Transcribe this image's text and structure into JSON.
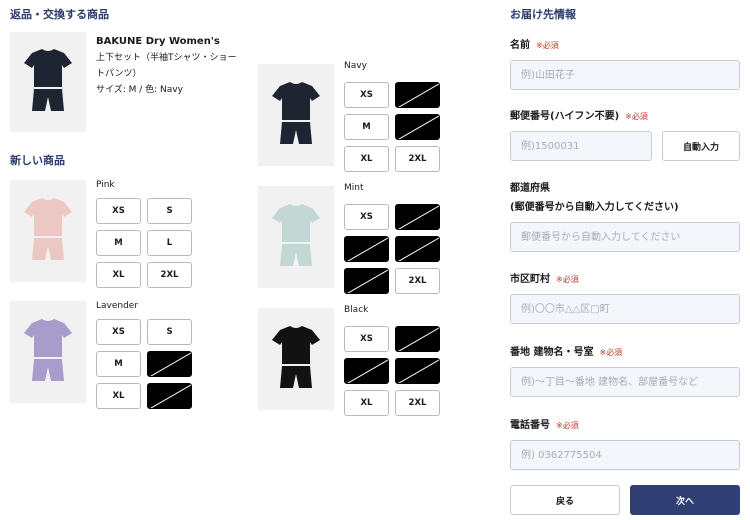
{
  "returns": {
    "title": "返品・交換する商品",
    "product": {
      "name": "BAKUNE Dry Women's",
      "desc1": "上下セット（半袖Tシャツ・ショー",
      "desc2": "トパンツ）",
      "spec": "サイズ: M / 色: Navy"
    }
  },
  "new_items": {
    "title": "新しい商品",
    "colors": [
      {
        "name": "Pink",
        "swatch": "#ecc8c4",
        "sizes": [
          {
            "label": "XS",
            "available": true
          },
          {
            "label": "S",
            "available": true
          },
          {
            "label": "M",
            "available": true
          },
          {
            "label": "L",
            "available": true
          },
          {
            "label": "XL",
            "available": true
          },
          {
            "label": "2XL",
            "available": true
          }
        ]
      },
      {
        "name": "Lavender",
        "swatch": "#a79ccb",
        "sizes": [
          {
            "label": "XS",
            "available": true
          },
          {
            "label": "S",
            "available": true
          },
          {
            "label": "M",
            "available": true
          },
          {
            "label": "L",
            "available": false
          },
          {
            "label": "XL",
            "available": true
          },
          {
            "label": "2XL",
            "available": false
          }
        ]
      },
      {
        "name": "Navy",
        "swatch": "#1f2433",
        "sizes": [
          {
            "label": "XS",
            "available": true
          },
          {
            "label": "S",
            "available": false
          },
          {
            "label": "M",
            "available": true
          },
          {
            "label": "L",
            "available": false
          },
          {
            "label": "XL",
            "available": true
          },
          {
            "label": "2XL",
            "available": true
          }
        ]
      },
      {
        "name": "Mint",
        "swatch": "#c3d8d4",
        "sizes": [
          {
            "label": "XS",
            "available": true
          },
          {
            "label": "S",
            "available": false
          },
          {
            "label": "M",
            "available": false
          },
          {
            "label": "L",
            "available": false
          },
          {
            "label": "XL",
            "available": false
          },
          {
            "label": "2XL",
            "available": true
          }
        ]
      },
      {
        "name": "Black",
        "swatch": "#121212",
        "sizes": [
          {
            "label": "XS",
            "available": true
          },
          {
            "label": "S",
            "available": false
          },
          {
            "label": "M",
            "available": false
          },
          {
            "label": "L",
            "available": false
          },
          {
            "label": "XL",
            "available": true
          },
          {
            "label": "2XL",
            "available": true
          }
        ]
      }
    ]
  },
  "delivery": {
    "title": "お届け先情報",
    "required_mark": "※必須",
    "fields": {
      "name": {
        "label": "名前",
        "placeholder": "例)山田花子"
      },
      "postal": {
        "label": "郵便番号(ハイフン不要)",
        "placeholder": "例)1500031",
        "button": "自動入力"
      },
      "prefecture": {
        "label1": "都道府県",
        "label2": "(郵便番号から自動入力してください)",
        "placeholder": "郵便番号から自動入力してください"
      },
      "city": {
        "label": "市区町村",
        "placeholder": "例)〇〇市△△区□町"
      },
      "address": {
        "label": "番地 建物名・号室",
        "placeholder": "例)〜丁目〜番地 建物名、部屋番号など"
      },
      "phone": {
        "label": "電話番号",
        "placeholder": "例) 0362775504"
      }
    },
    "back_label": "戻る",
    "next_label": "次へ"
  }
}
